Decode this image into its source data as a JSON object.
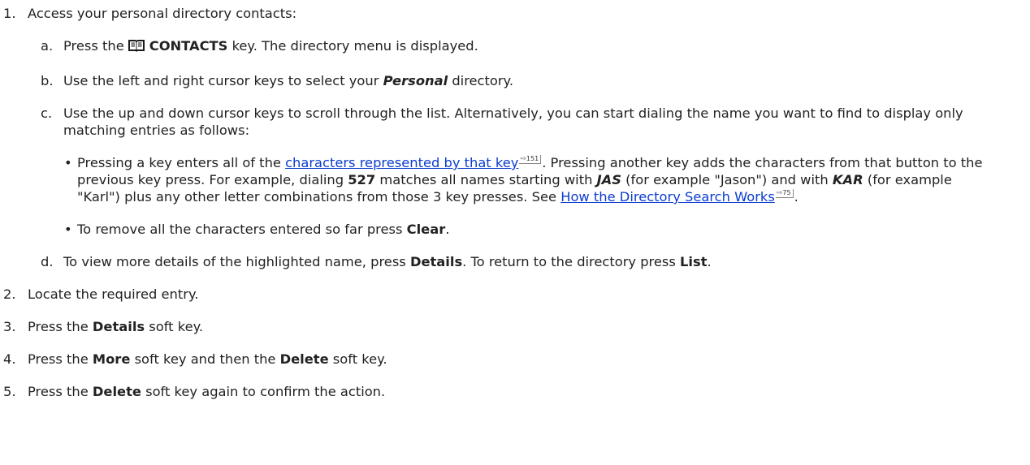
{
  "steps": [
    {
      "num": "1.",
      "text": "Access your personal directory contacts:"
    },
    {
      "num": "2.",
      "text": "Locate the required entry."
    },
    {
      "num": "3.",
      "pre": "Press the ",
      "bold": "Details",
      "post": " soft key."
    },
    {
      "num": "4.",
      "pre": "Press the ",
      "bold": "More",
      "mid": " soft key and then the ",
      "bold2": "Delete",
      "post": " soft key."
    },
    {
      "num": "5.",
      "pre": "Press the ",
      "bold": "Delete",
      "post": " soft key again to confirm the action."
    }
  ],
  "substeps": {
    "a": {
      "letter": "a.",
      "pre": "Press the",
      "bold": "CONTACTS",
      "post": " key. The directory menu is displayed.",
      "icon": "book-icon"
    },
    "b": {
      "letter": "b.",
      "pre": "Use the left and right cursor keys to select your ",
      "emph": "Personal",
      "post": " directory."
    },
    "c": {
      "letter": "c.",
      "text": "Use the up and down cursor keys to scroll through the list. Alternatively, you can start dialing the name you want to find to display only matching entries as follows:"
    },
    "d": {
      "letter": "d.",
      "pre": "To view more details of the highlighted name, press ",
      "bold": "Details",
      "mid": ". To return to the directory press ",
      "bold2": "List",
      "post": "."
    }
  },
  "bullets": {
    "b1": {
      "pre": "Pressing a key enters all of the ",
      "link": "characters represented by that key",
      "link_page": "151",
      "t1": ". Pressing another key adds the characters from that button to the previous key press. For example, dialing ",
      "digits": "527",
      "t2": " matches all names starting with ",
      "e1": "JAS",
      "t3": " (for example \"Jason\") and with ",
      "e2": "KAR",
      "t4": " (for example \"Karl\") plus any other letter combinations from those 3 key presses. See ",
      "link2": "How the Directory Search Works",
      "link2_page": "75",
      "post": "."
    },
    "b2": {
      "pre": "To remove all the characters entered so far press ",
      "bold": "Clear",
      "post": "."
    }
  },
  "bullet_glyph": "•",
  "colors": {
    "link": "#0a3ccf",
    "text": "#222222"
  }
}
